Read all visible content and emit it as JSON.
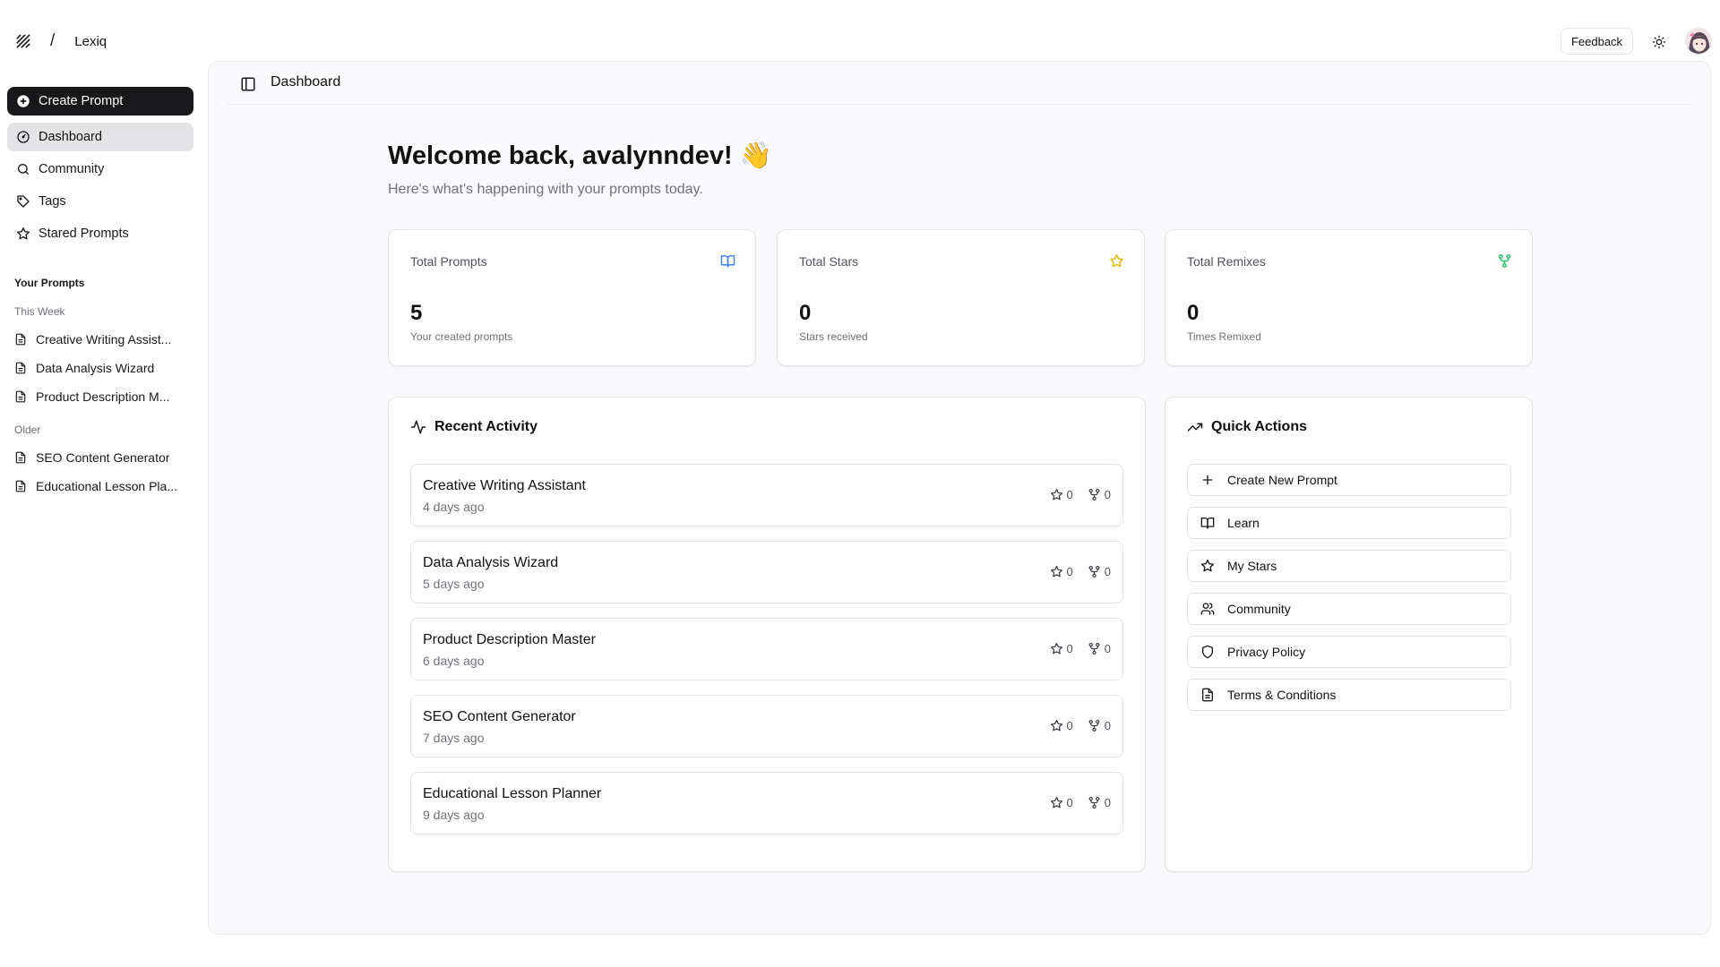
{
  "app": {
    "name": "Lexiq",
    "separator": "/"
  },
  "topbar": {
    "feedback_label": "Feedback",
    "avatar": "user-avatar"
  },
  "sidebar": {
    "create_label": "Create Prompt",
    "nav": [
      {
        "label": "Dashboard",
        "icon": "gauge-icon",
        "active": true
      },
      {
        "label": "Community",
        "icon": "search-icon"
      },
      {
        "label": "Tags",
        "icon": "tag-icon"
      },
      {
        "label": "Stared Prompts",
        "icon": "star-icon"
      }
    ],
    "your_prompts_label": "Your Prompts",
    "this_week_label": "This Week",
    "this_week": [
      "Creative Writing Assist...",
      "Data Analysis Wizard",
      "Product Description M..."
    ],
    "older_label": "Older",
    "older": [
      "SEO Content Generator",
      "Educational Lesson Pla..."
    ]
  },
  "main": {
    "header_title": "Dashboard",
    "welcome": "Welcome back, avalynndev! 👋",
    "welcome_sub": "Here's what's happening with your prompts today.",
    "stats": [
      {
        "label": "Total Prompts",
        "value": "5",
        "sub": "Your created prompts",
        "icon": "book-open-icon",
        "color": "#3b82f6"
      },
      {
        "label": "Total Stars",
        "value": "0",
        "sub": "Stars received",
        "icon": "star-icon",
        "color": "#eab308"
      },
      {
        "label": "Total Remixes",
        "value": "0",
        "sub": "Times Remixed",
        "icon": "git-fork-icon",
        "color": "#22c55e"
      }
    ],
    "recent_activity": {
      "title": "Recent Activity",
      "items": [
        {
          "name": "Creative Writing Assistant",
          "time": "4 days ago",
          "stars": "0",
          "remixes": "0"
        },
        {
          "name": "Data Analysis Wizard",
          "time": "5 days ago",
          "stars": "0",
          "remixes": "0"
        },
        {
          "name": "Product Description Master",
          "time": "6 days ago",
          "stars": "0",
          "remixes": "0"
        },
        {
          "name": "SEO Content Generator",
          "time": "7 days ago",
          "stars": "0",
          "remixes": "0"
        },
        {
          "name": "Educational Lesson Planner",
          "time": "9 days ago",
          "stars": "0",
          "remixes": "0"
        }
      ]
    },
    "quick_actions": {
      "title": "Quick Actions",
      "items": [
        {
          "label": "Create New Prompt",
          "icon": "plus-icon"
        },
        {
          "label": "Learn",
          "icon": "book-open-icon"
        },
        {
          "label": "My Stars",
          "icon": "star-icon"
        },
        {
          "label": "Community",
          "icon": "users-icon"
        },
        {
          "label": "Privacy Policy",
          "icon": "shield-icon"
        },
        {
          "label": "Terms & Conditions",
          "icon": "file-text-icon"
        }
      ]
    }
  }
}
